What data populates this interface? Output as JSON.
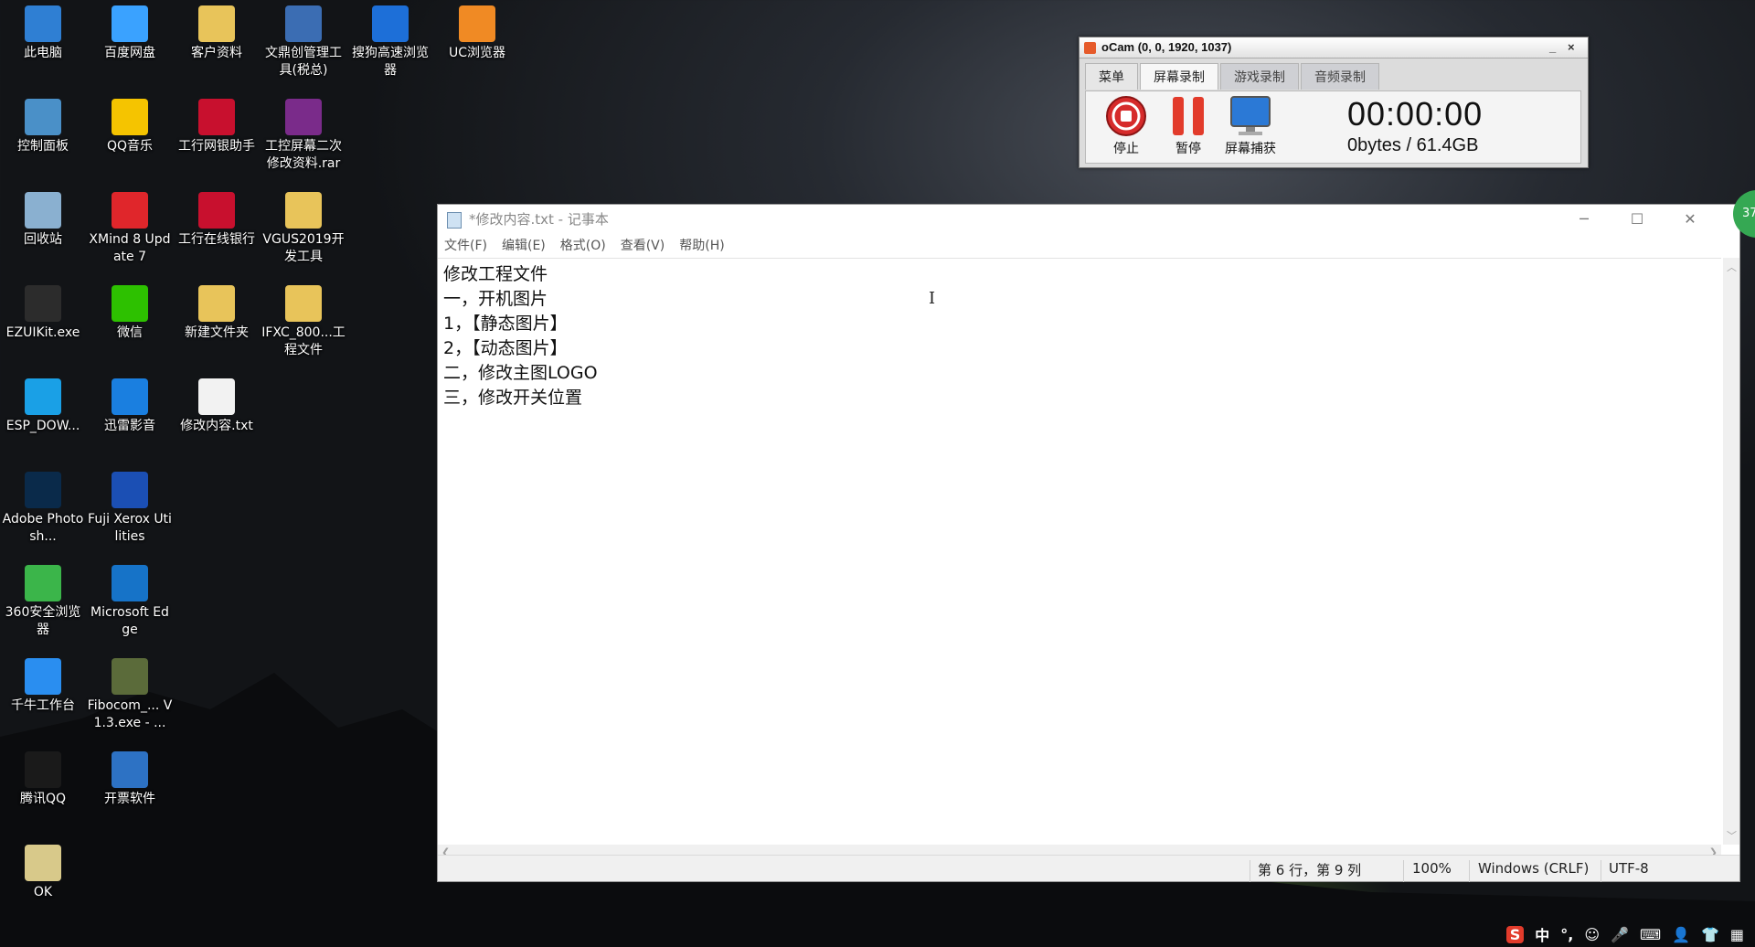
{
  "desktop": {
    "icons": [
      {
        "label": "此电脑",
        "color": "#2f7fd3",
        "glyph": "computer-icon"
      },
      {
        "label": "百度网盘",
        "color": "#3aa2ff",
        "glyph": "baidu-netdisk-icon"
      },
      {
        "label": "客户资料",
        "color": "#e8c45a",
        "glyph": "folder-icon"
      },
      {
        "label": "文鼎创管理工具(税总)",
        "color": "#3b6db3",
        "glyph": "tool-shortcut-icon"
      },
      {
        "label": "搜狗高速浏览器",
        "color": "#1d6fd8",
        "glyph": "sogou-browser-icon"
      },
      {
        "label": "UC浏览器",
        "color": "#f08a24",
        "glyph": "uc-browser-icon"
      },
      {
        "label": "控制面板",
        "color": "#4a90c8",
        "glyph": "control-panel-icon"
      },
      {
        "label": "QQ音乐",
        "color": "#f5c400",
        "glyph": "qq-music-icon"
      },
      {
        "label": "工行网银助手",
        "color": "#c8102e",
        "glyph": "icbc-icon"
      },
      {
        "label": "工控屏幕二次修改资料.rar",
        "color": "#7a2b8a",
        "glyph": "rar-archive-icon"
      },
      {
        "label": "回收站",
        "color": "#8ab0d0",
        "glyph": "recycle-bin-icon"
      },
      {
        "label": "XMind 8 Update 7",
        "color": "#e0262b",
        "glyph": "xmind-icon"
      },
      {
        "label": "工行在线银行",
        "color": "#c8102e",
        "glyph": "icbc-online-icon"
      },
      {
        "label": "VGUS2019开发工具",
        "color": "#e8c45a",
        "glyph": "folder-icon"
      },
      {
        "label": "EZUIKit.exe",
        "color": "#2c2c2c",
        "glyph": "camera-icon"
      },
      {
        "label": "微信",
        "color": "#2dc100",
        "glyph": "wechat-icon"
      },
      {
        "label": "新建文件夹",
        "color": "#e8c45a",
        "glyph": "folder-icon"
      },
      {
        "label": "IFXC_800...工程文件",
        "color": "#e8c45a",
        "glyph": "folder-icon"
      },
      {
        "label": "ESP_DOW...",
        "color": "#1aa0e6",
        "glyph": "gear-icon"
      },
      {
        "label": "迅雷影音",
        "color": "#1a7fe0",
        "glyph": "xunlei-player-icon"
      },
      {
        "label": "修改内容.txt",
        "color": "#f2f2f2",
        "glyph": "text-file-icon"
      },
      {
        "label": "Adobe Photosh...",
        "color": "#0a2a4a",
        "glyph": "photoshop-icon"
      },
      {
        "label": "Fuji Xerox Utilities",
        "color": "#1b4fb4",
        "glyph": "fuji-xerox-icon"
      },
      {
        "label": "360安全浏览器",
        "color": "#3bb54a",
        "glyph": "360-browser-icon"
      },
      {
        "label": "Microsoft Edge",
        "color": "#1673c8",
        "glyph": "edge-icon"
      },
      {
        "label": "千牛工作台",
        "color": "#2a8ef0",
        "glyph": "qianniu-icon"
      },
      {
        "label": "Fibocom_... V1.3.exe - ...",
        "color": "#5b6b3a",
        "glyph": "fibocom-icon"
      },
      {
        "label": "腾讯QQ",
        "color": "#1a1a1a",
        "glyph": "qq-icon"
      },
      {
        "label": "开票软件",
        "color": "#2d72c4",
        "glyph": "invoice-software-icon"
      },
      {
        "label": "OK",
        "color": "#d8c98a",
        "glyph": "zip-folder-icon"
      }
    ]
  },
  "ocam": {
    "title": "oCam (0, 0, 1920, 1037)",
    "minimize": "_",
    "close": "×",
    "tabs": [
      "菜单",
      "屏幕录制",
      "游戏录制",
      "音频录制"
    ],
    "buttons": {
      "stop": "停止",
      "pause": "暂停",
      "capture": "屏幕捕获"
    },
    "time": "00:00:00",
    "size": "0bytes / 61.4GB"
  },
  "notepad": {
    "title": "*修改内容.txt - 记事本",
    "menu": [
      "文件(F)",
      "编辑(E)",
      "格式(O)",
      "查看(V)",
      "帮助(H)"
    ],
    "lines": [
      "修改工程文件",
      "一，开机图片",
      "1，【静态图片】",
      "2，【动态图片】",
      "二，修改主图LOGO",
      "三，修改开关位置"
    ],
    "status": {
      "position": "第 6 行，第 9 列",
      "zoom": "100%",
      "line_ending": "Windows (CRLF)",
      "encoding": "UTF-8"
    }
  },
  "badge": "37",
  "tray": {
    "ime": "中",
    "punct": "°,"
  },
  "colors": {
    "accent": "#2f7fd3",
    "ocam_stop": "#d62b2b",
    "ocam_pause": "#e23b2b"
  }
}
